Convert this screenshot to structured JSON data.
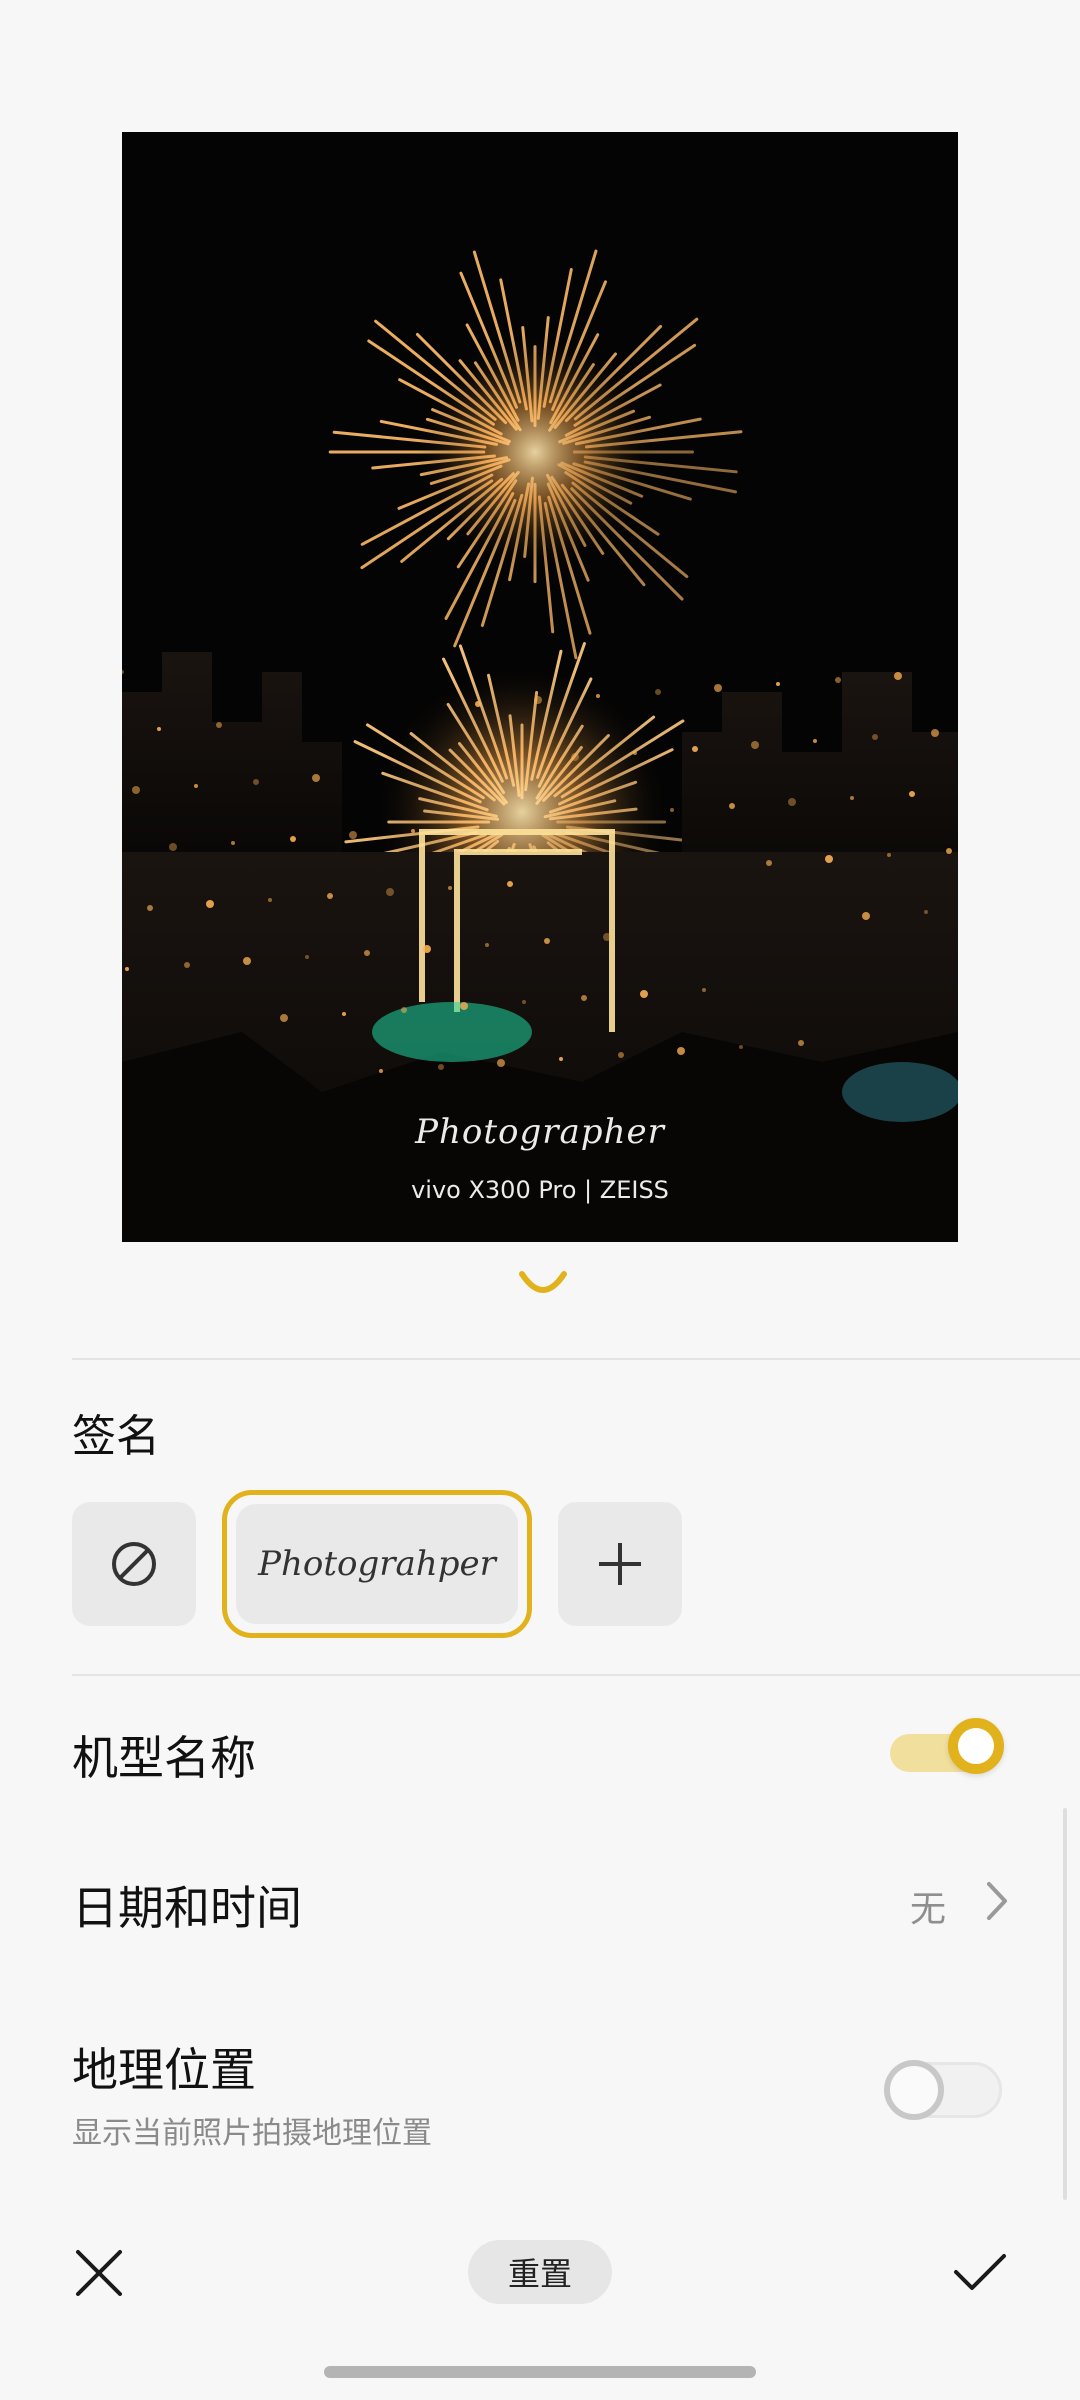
{
  "photo": {
    "watermark_signature": "Photographer",
    "watermark_model": "vivo X300 Pro | ZEISS"
  },
  "signature": {
    "title": "签名",
    "options": [
      "none-icon",
      "Photograhper",
      "plus-icon"
    ],
    "selected_label": "Photograhper"
  },
  "model_name": {
    "label": "机型名称",
    "enabled": true
  },
  "date_time": {
    "label": "日期和时间",
    "value": "无"
  },
  "location": {
    "label": "地理位置",
    "description": "显示当前照片拍摄地理位置",
    "enabled": false
  },
  "bottom_bar": {
    "reset_label": "重置"
  },
  "colors": {
    "accent": "#e1b21c",
    "background": "#f7f7f7"
  }
}
